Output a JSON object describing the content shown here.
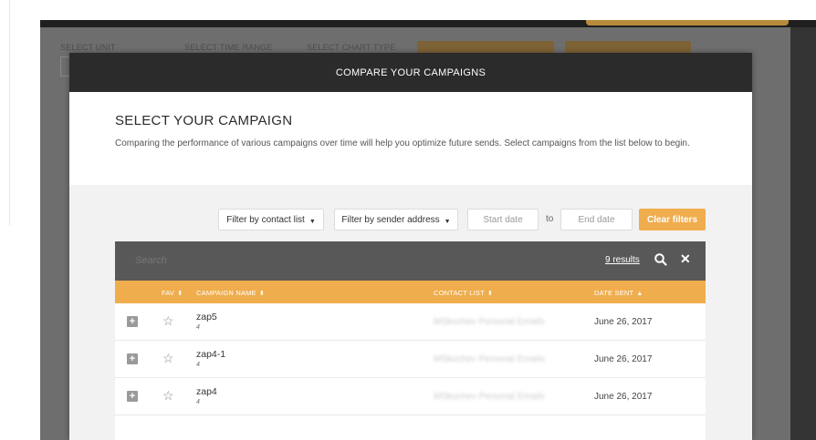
{
  "background_app": {
    "labels": [
      "SELECT UNIT",
      "SELECT TIME RANGE",
      "SELECT CHART TYPE"
    ]
  },
  "modal": {
    "title": "COMPARE YOUR CAMPAIGNS",
    "heading": "SELECT YOUR CAMPAIGN",
    "description": "Comparing the performance of various campaigns over time will help you optimize future sends. Select campaigns from the list below to begin."
  },
  "filters": {
    "contact_list": "Filter by contact list",
    "sender_address": "Filter by sender address",
    "start_date_placeholder": "Start date",
    "to_label": "to",
    "end_date_placeholder": "End date",
    "clear_label": "Clear filters"
  },
  "search": {
    "placeholder": "Search",
    "results": "9 results"
  },
  "table": {
    "headers": {
      "fav": "FAV",
      "campaign_name": "CAMPAIGN NAME",
      "contact_list": "CONTACT LIST",
      "date_sent": "DATE SENT"
    },
    "rows": [
      {
        "name": "zap5",
        "sub": "4",
        "contact_list": "MSkochev Personal Emails",
        "date": "June 26, 2017"
      },
      {
        "name": "zap4-1",
        "sub": "4",
        "contact_list": "MSkochev Personal Emails",
        "date": "June 26, 2017"
      },
      {
        "name": "zap4",
        "sub": "4",
        "contact_list": "MSkochev Personal Emails",
        "date": "June 26, 2017"
      }
    ]
  },
  "colors": {
    "accent": "#f0ad4e",
    "header_dark": "#2b2b2b",
    "search_bar": "#585858"
  }
}
